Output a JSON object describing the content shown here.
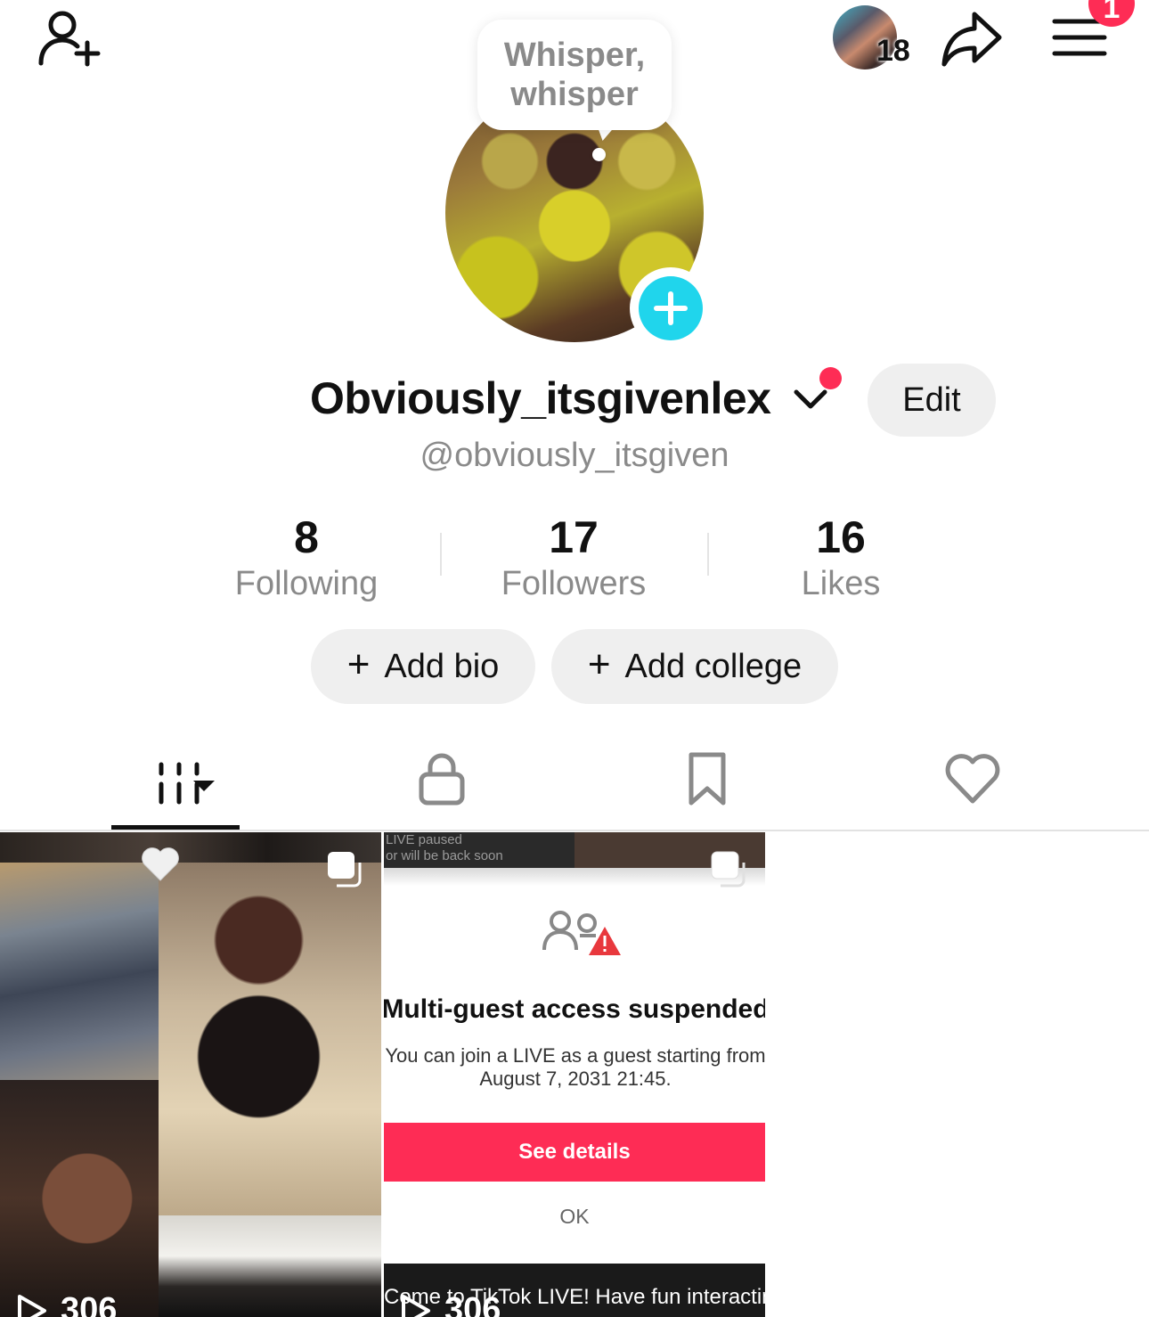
{
  "header": {
    "story_count": "18",
    "menu_badge_count": "1",
    "note_text": "Whisper, whisper"
  },
  "profile": {
    "display_name": "Obviously_itsgivenlex",
    "handle": "@obviously_itsgiven",
    "edit_label": "Edit"
  },
  "stats": [
    {
      "value": "8",
      "label": "Following"
    },
    {
      "value": "17",
      "label": "Followers"
    },
    {
      "value": "16",
      "label": "Likes"
    }
  ],
  "actions": {
    "add_bio": "Add bio",
    "add_college": "Add college",
    "plus": "+"
  },
  "tabs": [
    {
      "name": "videos",
      "icon": "grid-icon",
      "active": true
    },
    {
      "name": "private",
      "icon": "lock-icon"
    },
    {
      "name": "saved",
      "icon": "bookmark-icon"
    },
    {
      "name": "liked",
      "icon": "heart-icon"
    }
  ],
  "grid": [
    {
      "views": "306"
    },
    {
      "views": "306",
      "top_text": "LIVE paused\nor will be back soon",
      "dialog_title": "Multi-guest access suspended",
      "dialog_message": "You can join a LIVE as a guest starting from\nAugust 7, 2031 21:45.",
      "see_details": "See details",
      "ok": "OK",
      "caption": "Come to TikTok LIVE! Have fun interacting"
    }
  ],
  "colors": {
    "accent_red": "#fe2c55",
    "accent_cyan": "#20d5ec",
    "muted_text": "#8a8a8a",
    "pill_bg": "#efefef"
  }
}
